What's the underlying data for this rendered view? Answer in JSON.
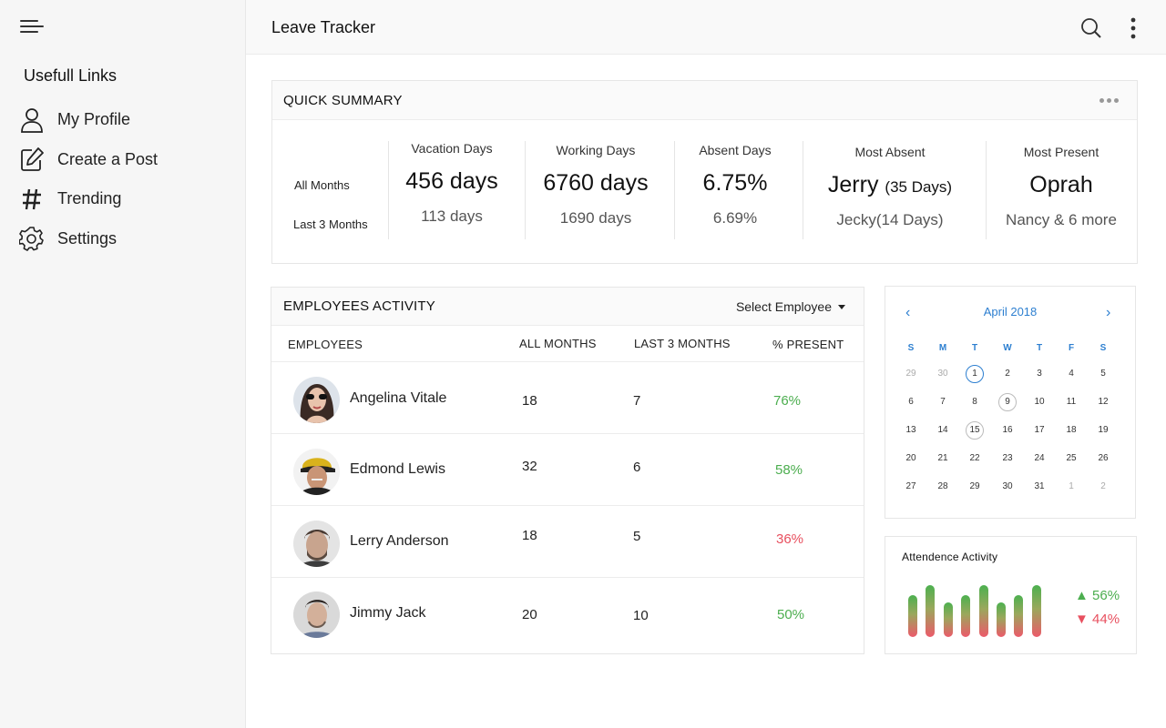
{
  "app": {
    "title": "Leave Tracker"
  },
  "sidebar": {
    "section_title": "Usefull Links",
    "items": [
      {
        "label": "My Profile",
        "icon": "user-icon"
      },
      {
        "label": "Create a Post",
        "icon": "edit-icon"
      },
      {
        "label": "Trending",
        "icon": "hash-icon"
      },
      {
        "label": "Settings",
        "icon": "gear-icon"
      }
    ]
  },
  "summary": {
    "title": "QUICK SUMMARY",
    "row_labels": [
      "All Months",
      "Last 3 Months"
    ],
    "vacation": {
      "label": "Vacation Days",
      "all": "456 days",
      "last3": "113 days"
    },
    "working": {
      "label": "Working Days",
      "all": "6760 days",
      "last3": "1690 days"
    },
    "absent": {
      "label": "Absent Days",
      "all": "6.75%",
      "last3": "6.69%"
    },
    "most_absent": {
      "label": "Most Absent",
      "all_name": "Jerry",
      "all_days": "(35 Days)",
      "last3": "Jecky(14 Days)"
    },
    "most_present": {
      "label": "Most Present",
      "all": "Oprah",
      "last3": "Nancy & 6 more"
    }
  },
  "activity": {
    "title": "EMPLOYEES ACTIVITY",
    "select_label": "Select Employee",
    "columns": [
      "EMPLOYEES",
      "ALL MONTHS",
      "LAST 3 MONTHS",
      "% PRESENT"
    ],
    "rows": [
      {
        "name": "Angelina Vitale",
        "all": "18",
        "last3": "7",
        "present": "76%",
        "status": "good"
      },
      {
        "name": "Edmond Lewis",
        "all": "32",
        "last3": "6",
        "present": "58%",
        "status": "good"
      },
      {
        "name": "Lerry Anderson",
        "all": "18",
        "last3": "5",
        "present": "36%",
        "status": "bad"
      },
      {
        "name": "Jimmy Jack",
        "all": "20",
        "last3": "10",
        "present": "50%",
        "status": "good"
      }
    ]
  },
  "calendar": {
    "month_label": "April 2018",
    "prev": "‹",
    "next": "›",
    "weekdays": [
      "S",
      "M",
      "T",
      "W",
      "T",
      "F",
      "S"
    ],
    "weeks": [
      [
        "29",
        "30",
        "1",
        "2",
        "3",
        "4",
        "5"
      ],
      [
        "6",
        "7",
        "8",
        "9",
        "10",
        "11",
        "12"
      ],
      [
        "13",
        "14",
        "15",
        "16",
        "17",
        "18",
        "19"
      ],
      [
        "20",
        "21",
        "22",
        "23",
        "24",
        "25",
        "26"
      ],
      [
        "27",
        "28",
        "29",
        "30",
        "31",
        "1",
        "2"
      ]
    ],
    "today": "1",
    "marked": [
      "9",
      "15"
    ]
  },
  "attendance": {
    "title": "Attendence  Activity",
    "up": "▲ 56%",
    "down": "▼ 44%",
    "bar_levels": [
      0.74,
      0.92,
      0.62,
      0.74,
      0.92,
      0.62,
      0.74,
      0.92
    ]
  },
  "colors": {
    "accent": "#2d7fd0",
    "good": "#4cae4f",
    "bad": "#e8505f"
  }
}
